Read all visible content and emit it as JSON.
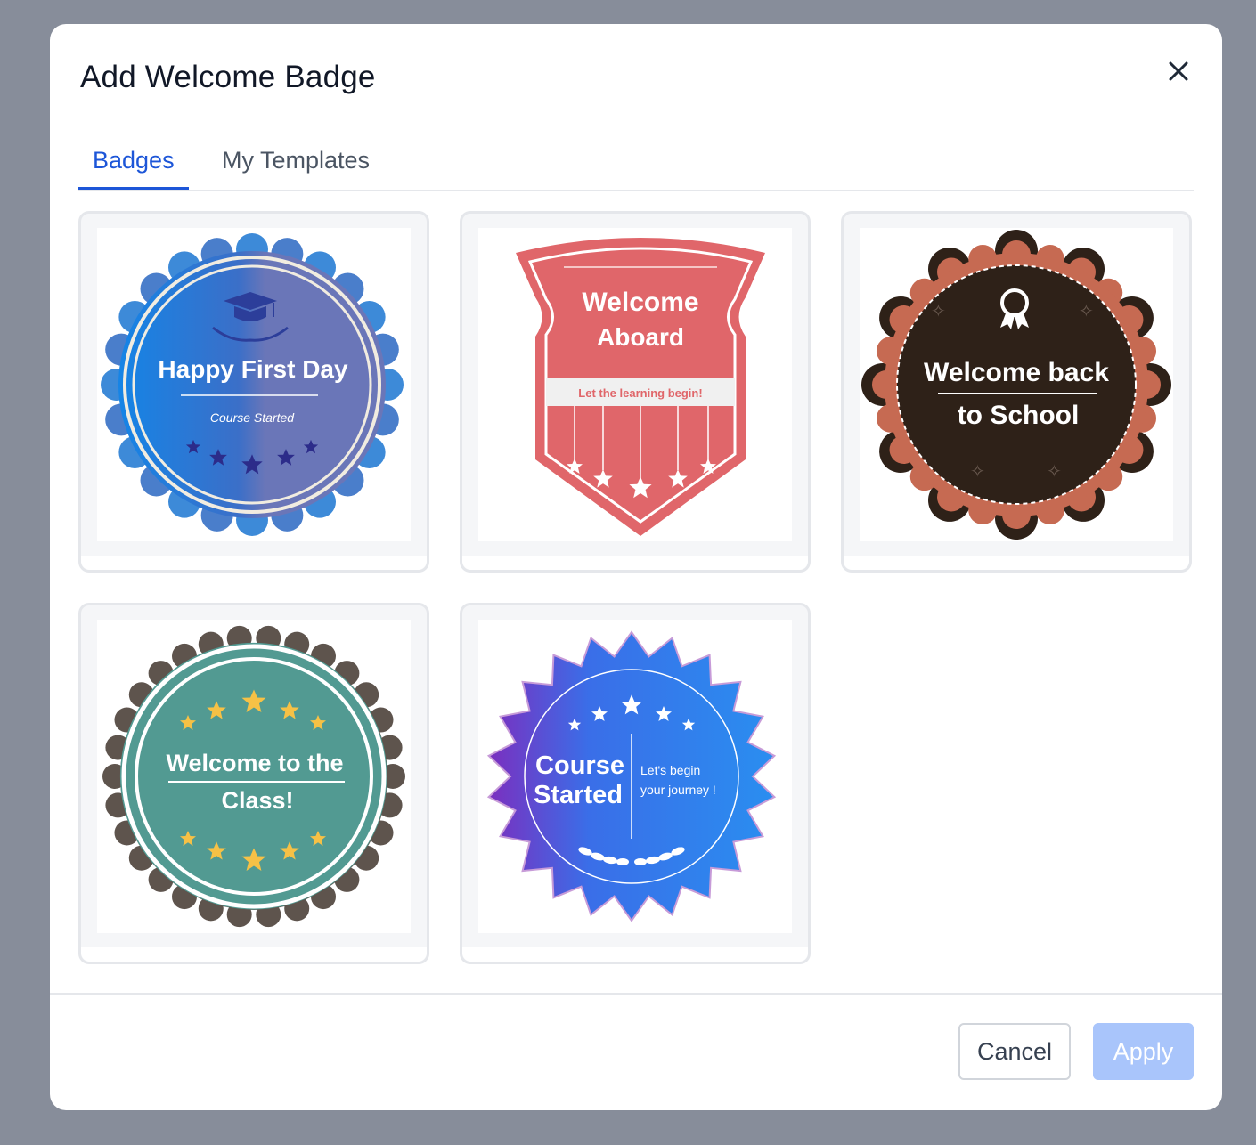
{
  "dialog": {
    "title": "Add Welcome Badge",
    "close_icon": "close-icon"
  },
  "tabs": [
    {
      "label": "Badges",
      "active": true
    },
    {
      "label": "My Templates",
      "active": false
    }
  ],
  "badges": [
    {
      "name": "happy-first-day",
      "title": "Happy First Day",
      "subtitle": "Course Started",
      "colors": [
        "#1a7ae0",
        "#6a76b8"
      ]
    },
    {
      "name": "welcome-aboard",
      "title_line1": "Welcome",
      "title_line2": "Aboard",
      "subtitle": "Let the learning begin!",
      "colors": [
        "#e0666a"
      ]
    },
    {
      "name": "welcome-back-to-school",
      "title_line1": "Welcome back",
      "title_line2": "to School",
      "colors": [
        "#2e2118",
        "#c66a52"
      ]
    },
    {
      "name": "welcome-to-the-class",
      "title_line1": "Welcome to the",
      "title_line2": "Class!",
      "colors": [
        "#529a92",
        "#5e544d"
      ]
    },
    {
      "name": "course-started",
      "title_line1": "Course",
      "title_line2": "Started",
      "subtitle_line1": "Let's begin",
      "subtitle_line2": "your journey !",
      "colors": [
        "#7b2fbf",
        "#2a8ef0"
      ]
    }
  ],
  "footer": {
    "cancel_label": "Cancel",
    "apply_label": "Apply"
  },
  "colors": {
    "accent": "#1d56d8",
    "apply_disabled": "#a9c5fb",
    "overlay": "#878d9a"
  }
}
